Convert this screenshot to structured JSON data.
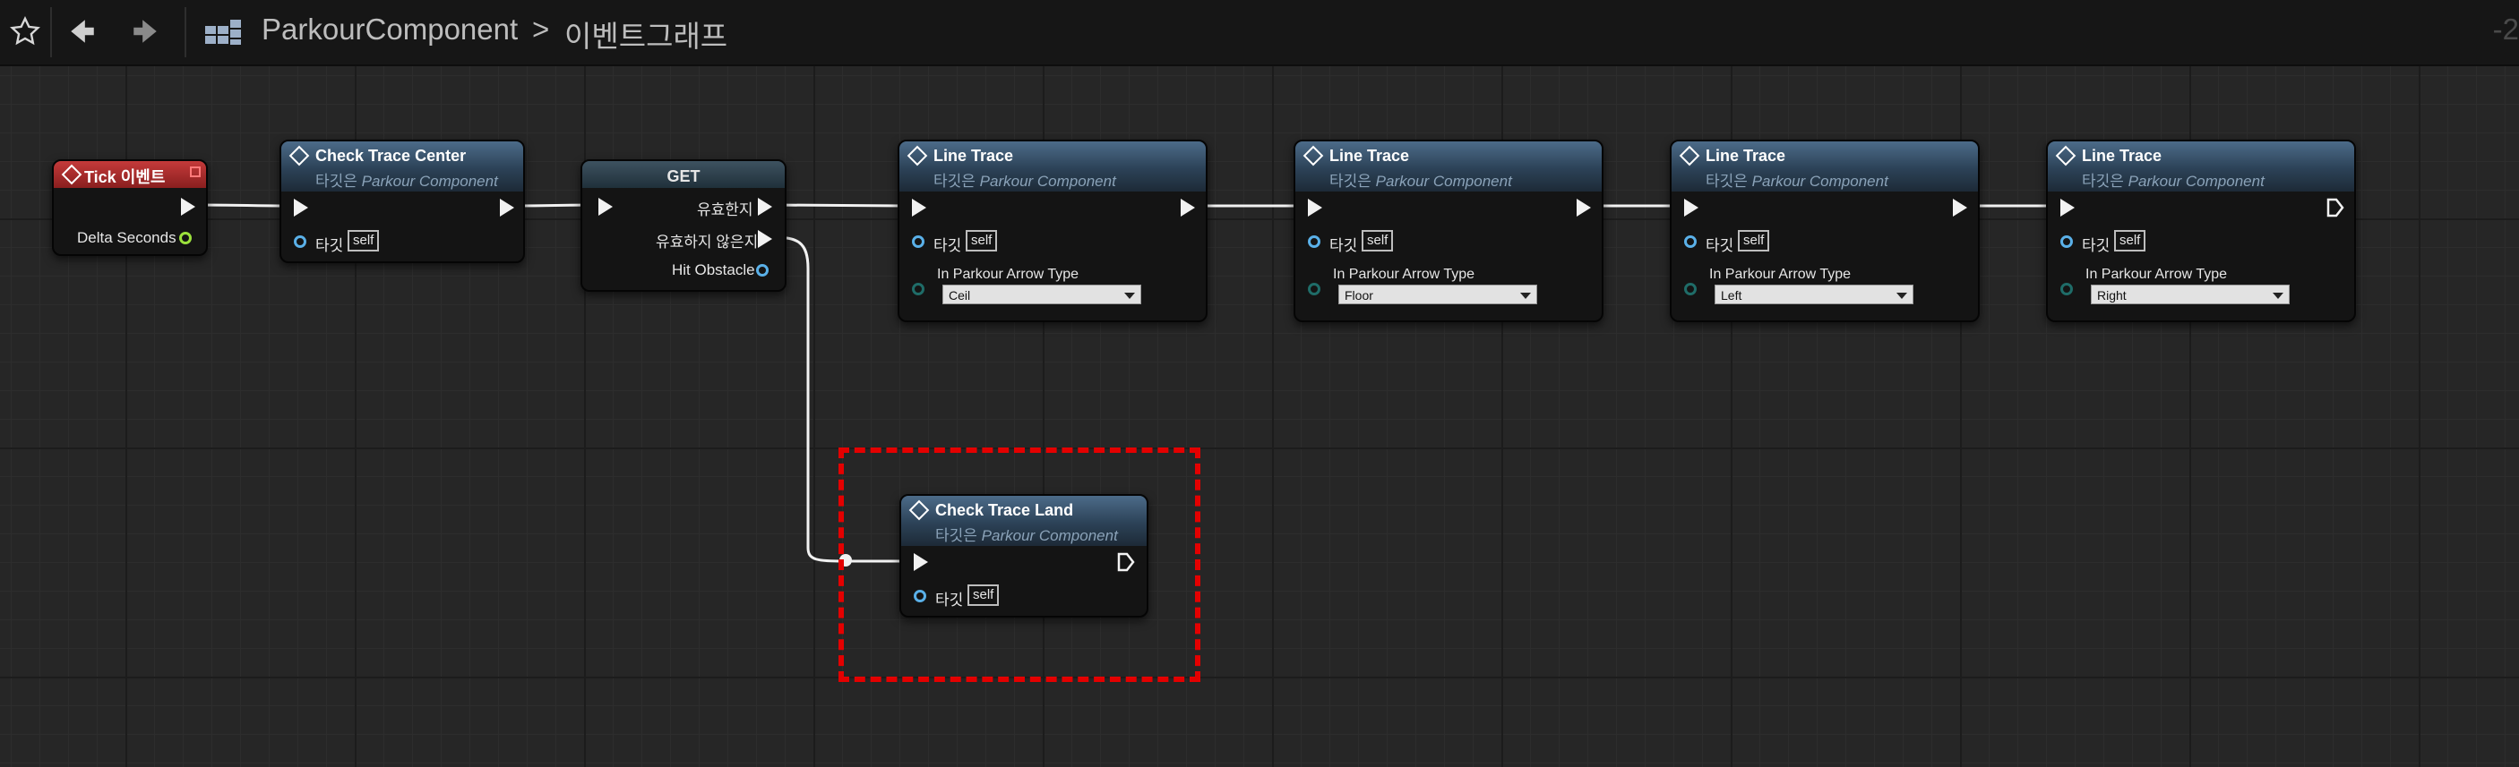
{
  "toolbar": {
    "favorite_icon": "star-outline-icon",
    "back_icon": "arrow-left-icon",
    "forward_icon": "arrow-right-icon",
    "blueprint_icon": "blueprint-grid-icon",
    "breadcrumb_component": "ParkourComponent",
    "breadcrumb_separator": ">",
    "breadcrumb_graph": "이벤트그래프",
    "zoom_label": "-2"
  },
  "nodes": {
    "tick": {
      "title": "Tick 이벤트",
      "delta_seconds": "Delta Seconds",
      "header_color": "#b02a2a"
    },
    "check_trace_center": {
      "title": "Check Trace Center",
      "subtitle_prefix": "타깃은",
      "subtitle_target": "Parkour Component",
      "target_label": "타깃",
      "target_value": "self"
    },
    "get": {
      "title": "GET",
      "valid": "유효한지",
      "not_valid": "유효하지 않은지",
      "hit_obstacle": "Hit Obstacle"
    },
    "line_trace_1": {
      "title": "Line Trace",
      "subtitle_prefix": "타깃은",
      "subtitle_target": "Parkour Component",
      "target_label": "타깃",
      "target_value": "self",
      "arrow_label": "In Parkour Arrow Type",
      "arrow_value": "Ceil"
    },
    "line_trace_2": {
      "title": "Line Trace",
      "subtitle_prefix": "타깃은",
      "subtitle_target": "Parkour Component",
      "target_label": "타깃",
      "target_value": "self",
      "arrow_label": "In Parkour Arrow Type",
      "arrow_value": "Floor"
    },
    "line_trace_3": {
      "title": "Line Trace",
      "subtitle_prefix": "타깃은",
      "subtitle_target": "Parkour Component",
      "target_label": "타깃",
      "target_value": "self",
      "arrow_label": "In Parkour Arrow Type",
      "arrow_value": "Left"
    },
    "line_trace_4": {
      "title": "Line Trace",
      "subtitle_prefix": "타깃은",
      "subtitle_target": "Parkour Component",
      "target_label": "타깃",
      "target_value": "self",
      "arrow_label": "In Parkour Arrow Type",
      "arrow_value": "Right"
    },
    "check_trace_land": {
      "title": "Check Trace Land",
      "subtitle_prefix": "타깃은",
      "subtitle_target": "Parkour Component",
      "target_label": "타깃",
      "target_value": "self"
    }
  },
  "colors": {
    "graph_background": "#262626",
    "node_header_blue": "#2c4257",
    "object_pin": "#5ab0e8",
    "float_pin": "#9be03c",
    "enum_pin": "#1f6c68",
    "highlight": "#e40000"
  }
}
